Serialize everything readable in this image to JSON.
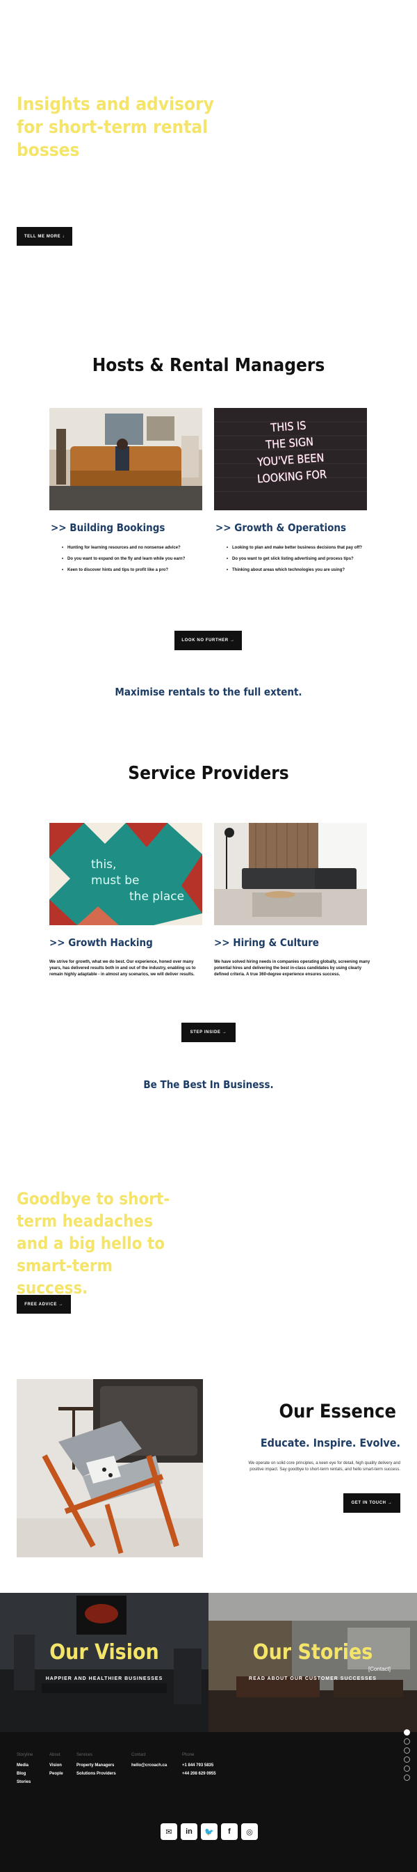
{
  "hero": {
    "title": "Insights and advisory for short-term rental bosses",
    "button": "TELL ME MORE ↓"
  },
  "hosts": {
    "heading": "Hosts & Rental Managers",
    "cards": [
      {
        "title": ">> Building Bookings",
        "bullets": [
          "Hunting for learning resources and no nonsense advice?",
          "Do you want to expand on the fly and learn while you earn?",
          "Keen to discover hints and tips to profit like a pro?"
        ]
      },
      {
        "title": ">> Growth & Operations",
        "bullets": [
          "Looking to plan and make better business decisions that pay off?",
          "Do you want to get slick listing advertising and process tips?",
          "Thinking about areas which technologies you are using?"
        ]
      }
    ],
    "neon_text": "THIS IS THE SIGN YOU'VE BEEN LOOKING FOR",
    "button": "LOOK NO FURTHER →",
    "tagline": "Maximise rentals to the full extent."
  },
  "providers": {
    "heading": "Service Providers",
    "neon_text": "this must be the place",
    "cards": [
      {
        "title": ">> Growth Hacking",
        "text": "We strive for growth, what we do best. Our experience, honed over many years, has delivered results both in and out of the industry, enabling us to remain highly adaptable - in almost any scenarios, we will deliver results."
      },
      {
        "title": ">> Hiring & Culture",
        "text": "We have solved hiring needs in companies operating globally, screening many potential hires and delivering the best in-class candidates by using clearly defined criteria. A true 360-degree experience ensures success."
      }
    ],
    "button": "STEP INSIDE →",
    "tagline": "Be The Best In Business."
  },
  "promo": {
    "title": "Goodbye to short-term headaches and a big hello to smart-term success.",
    "button": "FREE ADVICE →"
  },
  "essence": {
    "title": "Our Essence",
    "subtitle": "Educate. Inspire. Evolve.",
    "text": "We operate on solid core principles, a keen eye for detail, high quality delivery and positive impact. Say goodbye to short-term rentals, and hello smart-term success.",
    "button": "GET IN TOUCH →"
  },
  "banners": {
    "vision": {
      "title": "Our Vision",
      "subtitle": "HAPPIER AND HEALTHIER BUSINESSES"
    },
    "stories": {
      "title": "Our Stories",
      "subtitle": "READ ABOUT OUR CUSTOMER SUCCESSES",
      "contact": "[Contact]"
    }
  },
  "footer": {
    "columns": [
      {
        "heading": "Storyline",
        "links": [
          "Media",
          "Blog",
          "Stories"
        ]
      },
      {
        "heading": "About",
        "links": [
          "Vision",
          "People"
        ]
      },
      {
        "heading": "Services",
        "links": [
          "Property Managers",
          "Solutions Providers"
        ]
      },
      {
        "heading": "Contact",
        "links": [
          "hello@crcoach.ca"
        ]
      },
      {
        "heading": "Phone",
        "links": [
          "+1 844 793 5835",
          "+44 208 629 0955"
        ]
      }
    ],
    "socials": [
      {
        "icon": "mail-icon",
        "glyph": "✉"
      },
      {
        "icon": "linkedin-icon",
        "glyph": "in"
      },
      {
        "icon": "twitter-icon",
        "glyph": "🐦"
      },
      {
        "icon": "facebook-icon",
        "glyph": "f"
      },
      {
        "icon": "instagram-icon",
        "glyph": "◎"
      }
    ]
  },
  "colors": {
    "accent_yellow": "#f4e56a",
    "navy": "#1d3d66",
    "dark": "#111111"
  }
}
